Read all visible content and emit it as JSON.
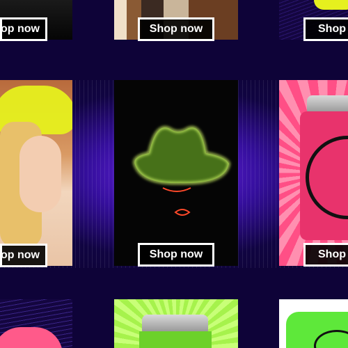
{
  "products": [
    {
      "id": "top-left",
      "button": "Shop now"
    },
    {
      "id": "top-center",
      "button": "Shop now"
    },
    {
      "id": "top-right",
      "button": "Shop n"
    },
    {
      "id": "mid-left",
      "button": "op now"
    },
    {
      "id": "mid-center",
      "button": "Shop now"
    },
    {
      "id": "mid-right",
      "button": "Shop n"
    },
    {
      "id": "bottom-left",
      "button": ""
    },
    {
      "id": "bottom-center",
      "button": ""
    },
    {
      "id": "bottom-right",
      "button": ""
    }
  ],
  "top_left_button_label": "op now",
  "colors": {
    "background": "#0e0338",
    "button_border": "#ffffff",
    "button_fill": "#000000",
    "neon_yellow": "#e6f01e",
    "neon_green": "#8ef22e",
    "pink": "#ff4f86"
  }
}
